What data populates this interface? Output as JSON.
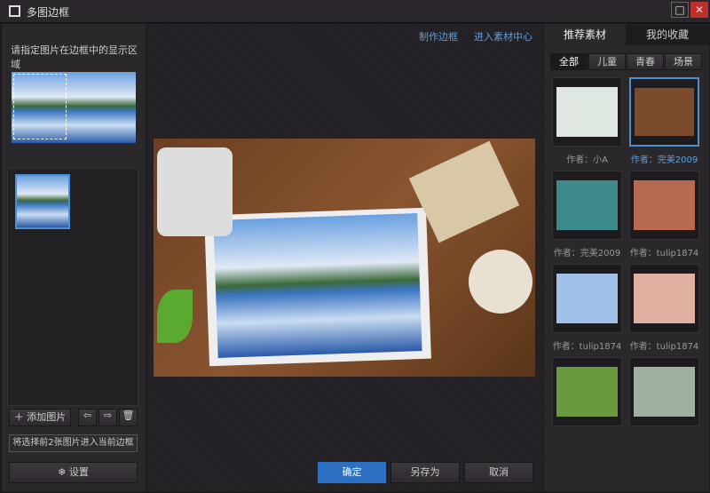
{
  "window": {
    "title": "多图边框",
    "minimize": "□",
    "close": "✕"
  },
  "left": {
    "hint": "请指定图片在边框中的显示区域",
    "add_image": "添加图片",
    "status": "将选择前2张图片进入当前边框",
    "settings": "设置"
  },
  "center": {
    "make_frame": "制作边框",
    "material_center": "进入素材中心",
    "confirm": "确定",
    "save_as": "另存为",
    "cancel": "取消"
  },
  "right": {
    "tabs": [
      "推荐素材",
      "我的收藏"
    ],
    "filters": [
      "全部",
      "儿童",
      "青春",
      "场景"
    ],
    "items": [
      {
        "author": "作者：小A",
        "color": "#dfe8e0"
      },
      {
        "author": "作者：完美2009",
        "color": "#7a4a2a"
      },
      {
        "author": "作者：完美2009",
        "color": "#3c8a8a"
      },
      {
        "author": "作者：tulip1874",
        "color": "#b86a50"
      },
      {
        "author": "作者：tulip1874",
        "color": "#9fc0e8"
      },
      {
        "author": "作者：tulip1874",
        "color": "#e0b0a0"
      },
      {
        "author": "",
        "color": "#6a9a40"
      },
      {
        "author": "",
        "color": "#a0b0a0"
      }
    ]
  }
}
